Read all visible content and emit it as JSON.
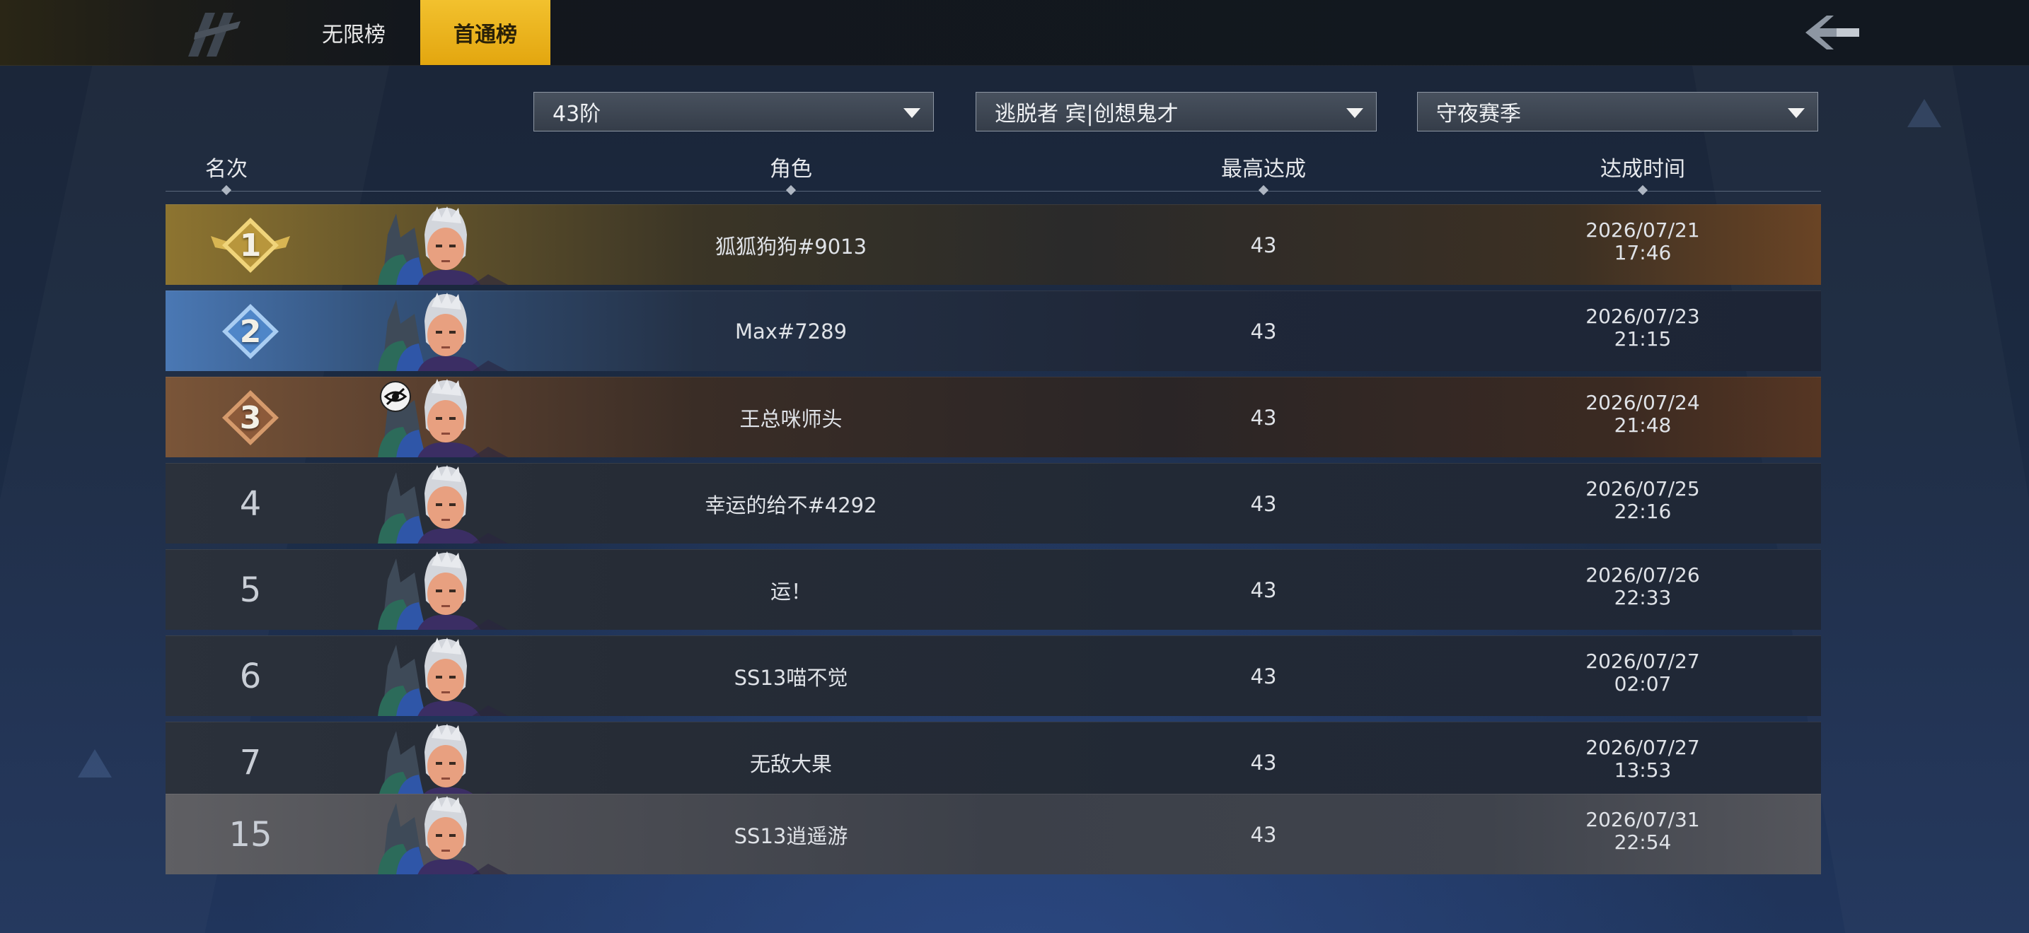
{
  "tabs": [
    {
      "label": "无限榜",
      "active": false
    },
    {
      "label": "首通榜",
      "active": true
    }
  ],
  "filters": {
    "level": "43阶",
    "role": "逃脱者 宾|创想鬼才",
    "season": "守夜赛季"
  },
  "columns": {
    "rank": "名次",
    "role": "角色",
    "best": "最高达成",
    "time": "达成时间"
  },
  "rows": [
    {
      "rank": "1",
      "name": "狐狐狗狗#9013",
      "score": "43",
      "date": "2026/07/21",
      "time": "17:46",
      "style": "gold"
    },
    {
      "rank": "2",
      "name": "Max#7289",
      "score": "43",
      "date": "2026/07/23",
      "time": "21:15",
      "style": "blue"
    },
    {
      "rank": "3",
      "name": "王总咪师头",
      "score": "43",
      "date": "2026/07/24",
      "time": "21:48",
      "style": "bronze",
      "hidden_badge": true
    },
    {
      "rank": "4",
      "name": "幸运的给不#4292",
      "score": "43",
      "date": "2026/07/25",
      "time": "22:16",
      "style": "plain"
    },
    {
      "rank": "5",
      "name": "运！",
      "score": "43",
      "date": "2026/07/26",
      "time": "22:33",
      "style": "plain"
    },
    {
      "rank": "6",
      "name": "SS13喵不觉",
      "score": "43",
      "date": "2026/07/27",
      "time": "02:07",
      "style": "plain"
    },
    {
      "rank": "7",
      "name": "无敌大果",
      "score": "43",
      "date": "2026/07/27",
      "time": "13:53",
      "style": "plain"
    },
    {
      "rank": "15",
      "name": "SS13逍遥游",
      "score": "43",
      "date": "2026/07/31",
      "time": "22:54",
      "style": "self"
    }
  ],
  "colors": {
    "tab_active": "#f2c12e",
    "gold": "#c9a13a",
    "silver_blue": "#5d8fd0",
    "bronze": "#a06a45"
  }
}
